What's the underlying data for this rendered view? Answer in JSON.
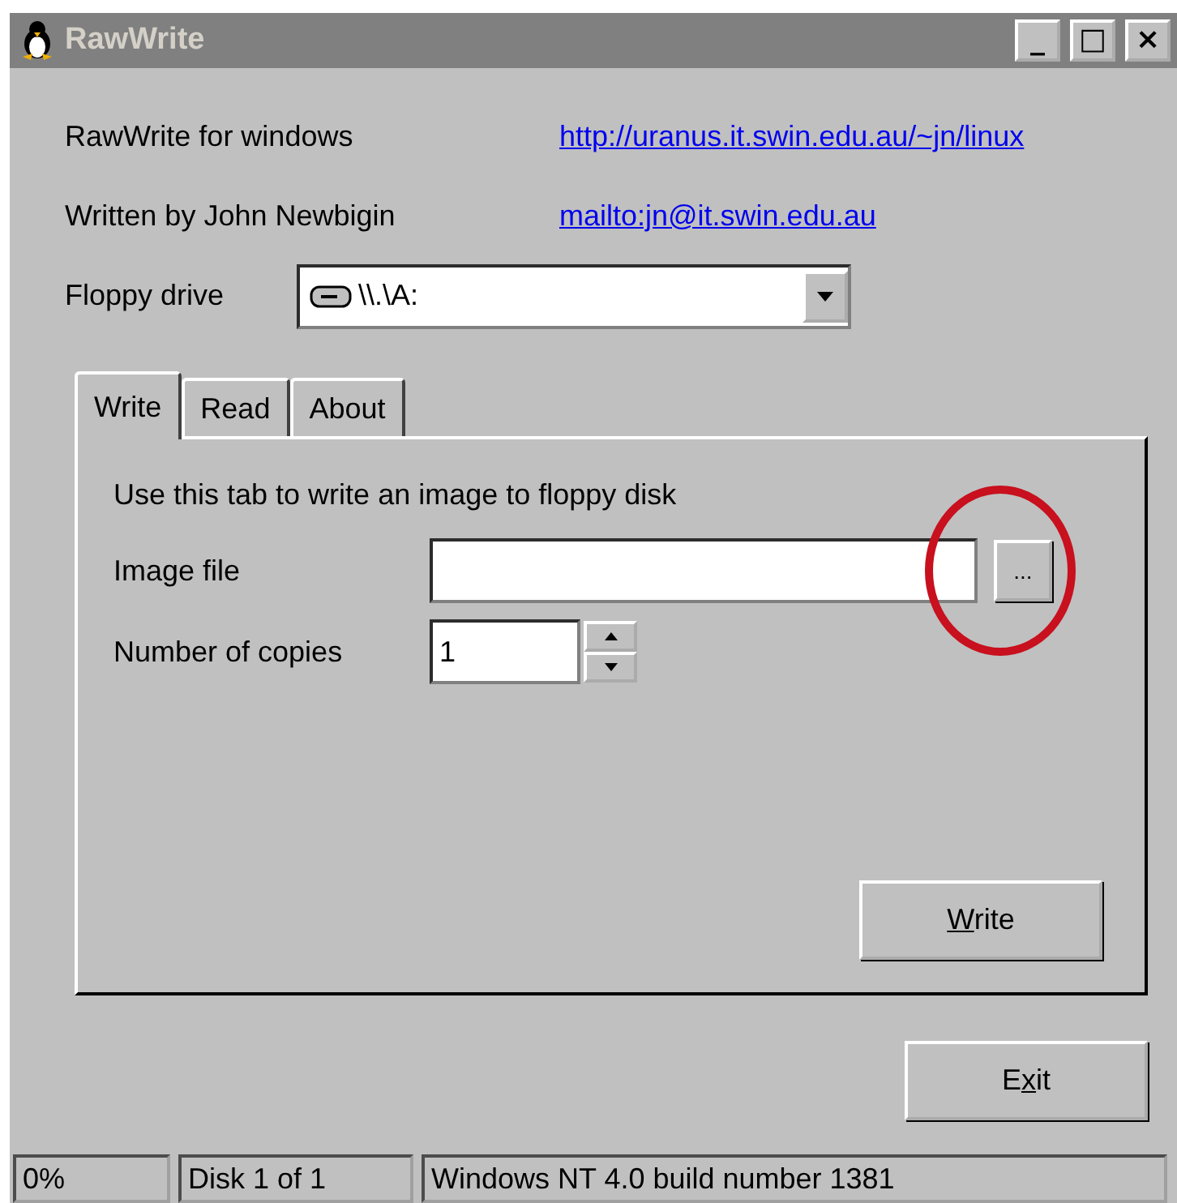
{
  "window": {
    "title": "RawWrite",
    "buttons": [
      "_",
      "□",
      "×"
    ]
  },
  "info": [
    {
      "label": "RawWrite for windows",
      "link": "http://uranus.it.swin.edu.au/~jn/linux"
    },
    {
      "label": "Written by John Newbigin",
      "link": "mailto:jn@it.swin.edu.au"
    }
  ],
  "floppy_drive": {
    "label": "Floppy drive",
    "value": "\\\\.\\A:"
  },
  "tabs": [
    {
      "label": "Write",
      "selected": true
    },
    {
      "label": "Read",
      "selected": false
    },
    {
      "label": "About",
      "selected": false
    }
  ],
  "write_tab": {
    "description": "Use this tab to write an image to floppy disk",
    "image_file": {
      "label": "Image file",
      "browse": "...",
      "highlighted": true
    },
    "copies": {
      "label": "Number of copies",
      "value": "1"
    },
    "write_button": {
      "access_key": "W",
      "label_after": "rite"
    }
  },
  "exit_button": {
    "label_before": "E",
    "access_key": "x",
    "label_after": "it"
  },
  "status_bar": [
    "0%",
    "Disk 1 of 1",
    "Windows NT 4.0 build number 1381"
  ]
}
